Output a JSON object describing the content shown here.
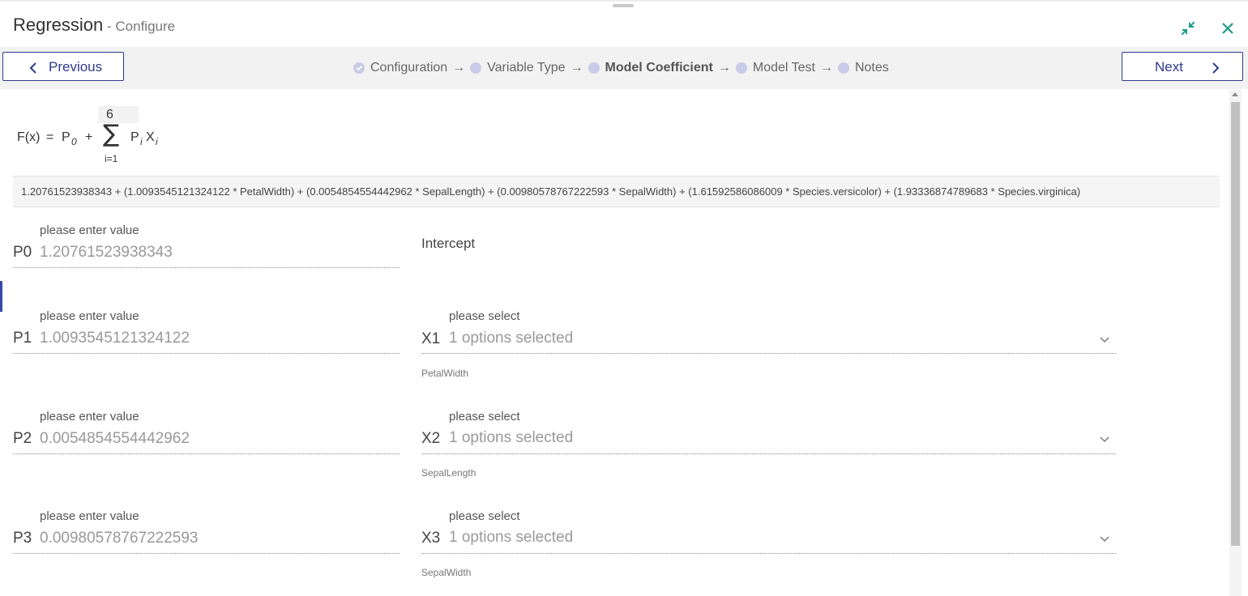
{
  "header": {
    "title": "Regression",
    "subtitle": " - Configure"
  },
  "nav": {
    "previous_label": "Previous",
    "next_label": "Next",
    "steps": [
      {
        "label": "Configuration",
        "state": "done"
      },
      {
        "label": "Variable Type",
        "state": "pending"
      },
      {
        "label": "Model Coefficient",
        "state": "active"
      },
      {
        "label": "Model Test",
        "state": "pending"
      },
      {
        "label": "Notes",
        "state": "pending"
      }
    ],
    "arrow": "→"
  },
  "formula": {
    "fx": "F(x)",
    "eq": "=",
    "p": "P",
    "p_sub": "0",
    "plus": "+",
    "sigma": "∑",
    "upper": "6",
    "lower": "i=1",
    "pi": "P",
    "pi_sub": "i",
    "xi": "X",
    "xi_sub": "i"
  },
  "equation": "1.20761523938343 + (1.0093545121324122 * PetalWidth) + (0.0054854554442962 * SepalLength) + (0.00980578767222593 * SepalWidth) + (1.61592586086009 * Species.versicolor) + (1.93336874789683 * Species.virginica)",
  "coefficients": [
    {
      "hint": "please enter value",
      "prefix": "P0",
      "value": "1.20761523938343",
      "right_label": "Intercept"
    },
    {
      "hint": "please enter value",
      "prefix": "P1",
      "value": "1.0093545121324122",
      "select_hint": "please select",
      "select_prefix": "X1",
      "select_value": "1 options selected",
      "variable": "PetalWidth"
    },
    {
      "hint": "please enter value",
      "prefix": "P2",
      "value": "0.0054854554442962",
      "select_hint": "please select",
      "select_prefix": "X2",
      "select_value": "1 options selected",
      "variable": "SepalLength"
    },
    {
      "hint": "please enter value",
      "prefix": "P3",
      "value": "0.00980578767222593",
      "select_hint": "please select",
      "select_prefix": "X3",
      "select_value": "1 options selected",
      "variable": "SepalWidth"
    }
  ],
  "icons": {
    "minimize": "collapse-arrows-icon",
    "close": "close-icon"
  },
  "colors": {
    "accent": "#2e3a8c",
    "teal": "#1a9a8a",
    "step_dot": "#c9cbe8"
  }
}
